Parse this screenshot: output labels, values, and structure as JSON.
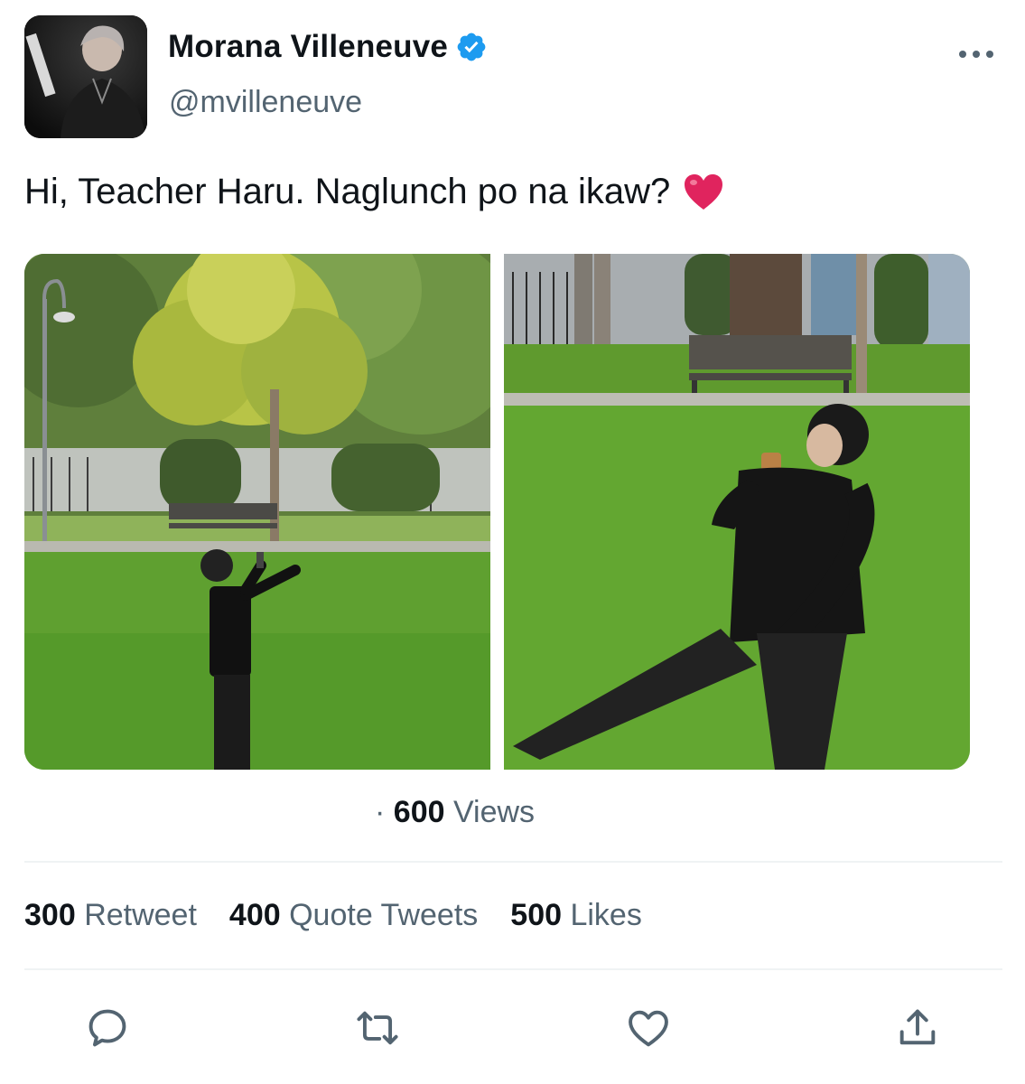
{
  "tweet": {
    "author": {
      "name": "Morana Villeneuve",
      "handle": "@mvilleneuve",
      "verified": true
    },
    "text": "Hi, Teacher Haru. Naglunch po na ikaw?",
    "emoji": "heart-emoji",
    "views": {
      "count": "600",
      "label": "Views",
      "separator": "·"
    },
    "stats": {
      "retweets": {
        "count": "300",
        "label": "Retweet"
      },
      "quotes": {
        "count": "400",
        "label": "Quote Tweets"
      },
      "likes": {
        "count": "500",
        "label": "Likes"
      }
    },
    "actions": [
      "reply-icon",
      "retweet-icon",
      "like-icon",
      "share-icon"
    ]
  },
  "colors": {
    "text": "#0f1419",
    "secondary": "#536471",
    "verified": "#1d9bf0",
    "heart": "#e0245e",
    "divider": "#eff3f4"
  }
}
